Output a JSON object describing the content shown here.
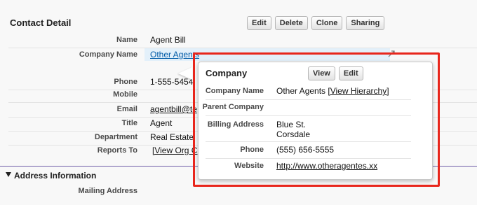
{
  "detail": {
    "title": "Contact Detail",
    "buttons": [
      "Edit",
      "Delete",
      "Clone",
      "Sharing"
    ],
    "fields": [
      {
        "label": "Name",
        "value": "Agent Bill"
      },
      {
        "label": "Company Name",
        "value": "Other Agents"
      },
      {
        "label": "Phone",
        "value": "1-555-5454"
      },
      {
        "label": "Mobile",
        "value": ""
      },
      {
        "label": "Email",
        "value": "agentbill@te"
      },
      {
        "label": "Title",
        "value": "Agent"
      },
      {
        "label": "Department",
        "value": "Real Estate"
      },
      {
        "label": "Reports To",
        "value": "[View Org C"
      }
    ]
  },
  "address_section": {
    "title": "Address Information",
    "mailing_label": "Mailing Address"
  },
  "popup": {
    "title": "Company",
    "buttons": [
      "View",
      "Edit"
    ],
    "rows": [
      {
        "label": "Company Name",
        "value": "Other Agents",
        "extra": "[View Hierarchy]"
      },
      {
        "label": "Parent Company",
        "value": ""
      },
      {
        "label": "Billing Address",
        "line1": "Blue St.",
        "line2": "Corsdale"
      },
      {
        "label": "Phone",
        "value": "(555) 656-5555"
      },
      {
        "label": "Website",
        "value": "http://www.otheragentes.xx"
      }
    ]
  },
  "colors": {
    "highlight_border": "#e8261c",
    "link": "#015ba7",
    "section_rule": "#6f5ea8"
  }
}
